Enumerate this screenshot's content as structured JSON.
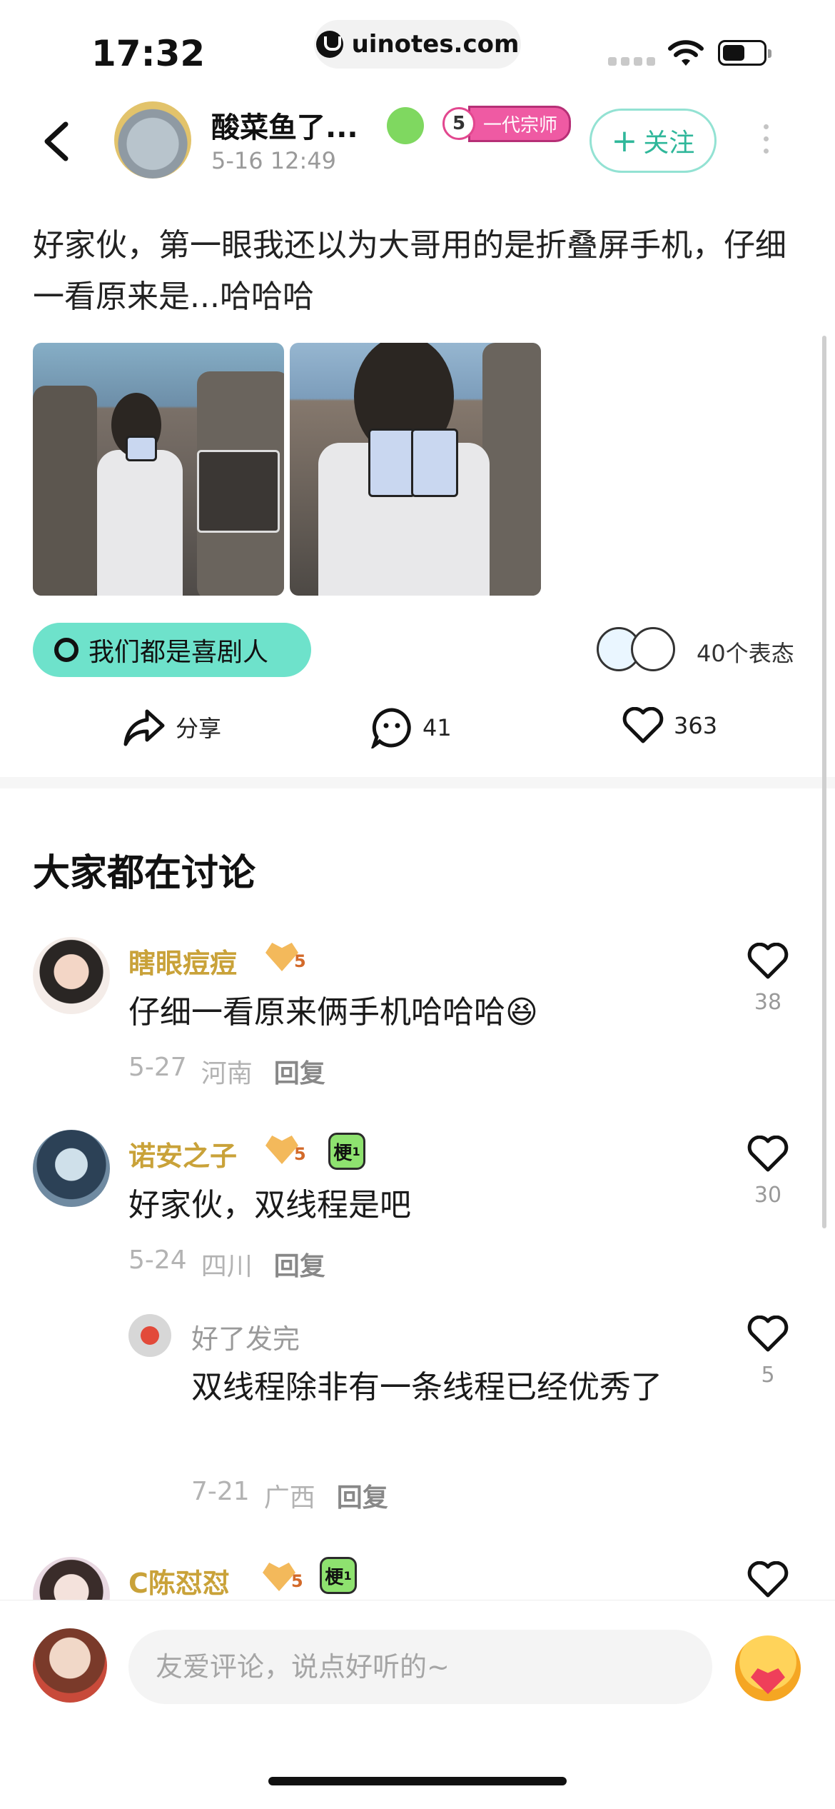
{
  "status_bar": {
    "time": "17:32",
    "url": "uinotes.com"
  },
  "post": {
    "author": {
      "name": "酸菜鱼了...",
      "time": "5-16 12:49",
      "level": "5",
      "level_title": "一代宗师"
    },
    "follow_label": "关注",
    "text": "好家伙，第一眼我还以为大哥用的是折叠屏手机，仔细一看原来是...哈哈哈",
    "topic": "我们都是喜剧人",
    "reactions_count": "40个表态",
    "share_label": "分享",
    "comment_count": "41",
    "like_count": "363"
  },
  "discussion": {
    "title": "大家都在讨论",
    "comments": [
      {
        "name": "瞎眼痘痘",
        "fan_level": "5",
        "text": "仔细一看原来俩手机哈哈哈😆",
        "date": "5-27",
        "location": "河南",
        "reply_label": "回复",
        "likes": "38"
      },
      {
        "name": "诺安之子",
        "fan_level": "5",
        "geng_level": "梗",
        "geng_num": "1",
        "text": "好家伙，双线程是吧",
        "date": "5-24",
        "location": "四川",
        "reply_label": "回复",
        "likes": "30"
      },
      {
        "name": "好了发完",
        "text": "双线程除非有一条线程已经优秀了",
        "date": "7-21",
        "location": "广西",
        "reply_label": "回复",
        "likes": "5"
      },
      {
        "name": "C陈怼怼",
        "fan_level": "5",
        "geng_level": "梗",
        "geng_num": "1"
      }
    ]
  },
  "input": {
    "placeholder": "友爱评论，说点好听的~"
  }
}
